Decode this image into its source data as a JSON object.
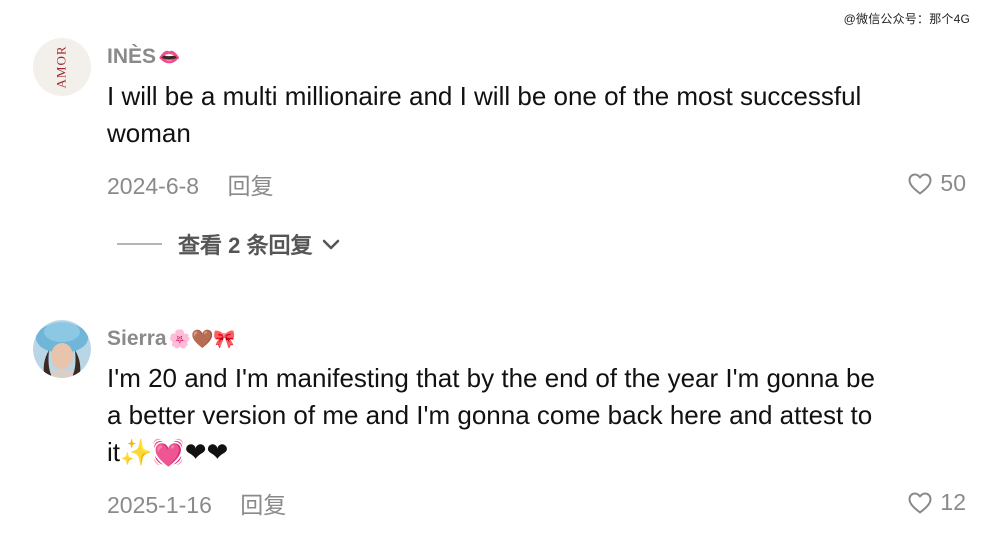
{
  "watermark": "@微信公众号：那个4G",
  "comments": [
    {
      "avatar_text": "AMOR",
      "username": "INÈS",
      "username_emoji": "👄",
      "text": "I will be a multi millionaire and I will be one of the most successful woman",
      "date": "2024-6-8",
      "reply_label": "回复",
      "likes": "50",
      "view_replies": "查看 2 条回复"
    },
    {
      "username": "Sierra",
      "username_emoji": "🌸🤎🎀",
      "text": "I'm 20 and I'm manifesting that by the end of the year I'm gonna be a better version of me and I'm gonna come back here and attest to it✨💓❤❤",
      "date": "2025-1-16",
      "reply_label": "回复",
      "likes": "12"
    }
  ],
  "icons": {
    "like": "heart-outline-icon",
    "expand": "chevron-down-icon"
  }
}
